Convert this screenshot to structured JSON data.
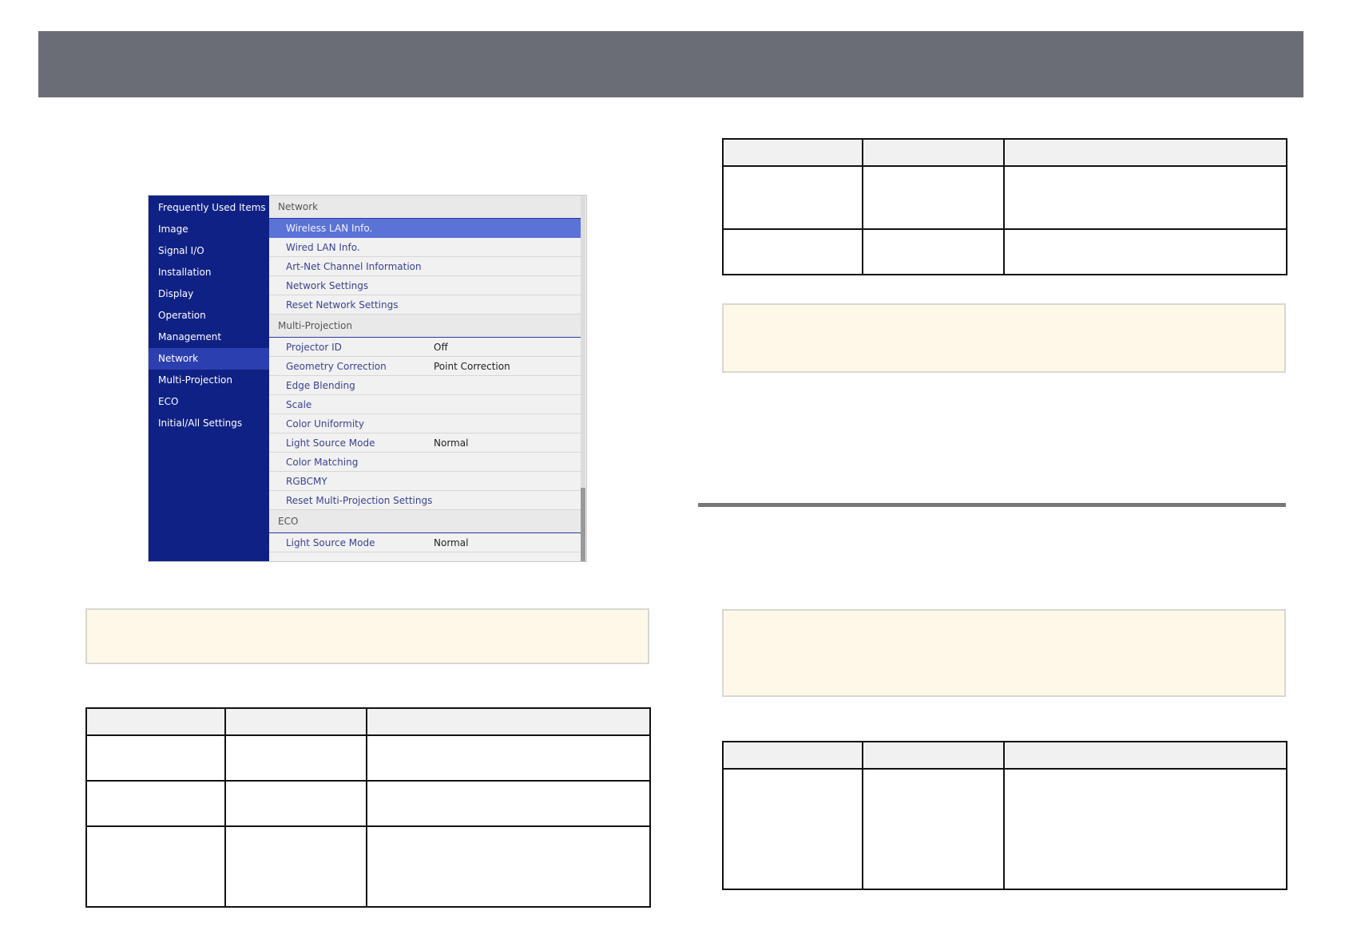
{
  "menu": {
    "sidebar": [
      {
        "label": "Frequently Used Items",
        "active": false
      },
      {
        "label": "Image",
        "active": false
      },
      {
        "label": "Signal I/O",
        "active": false
      },
      {
        "label": "Installation",
        "active": false
      },
      {
        "label": "Display",
        "active": false
      },
      {
        "label": "Operation",
        "active": false
      },
      {
        "label": "Management",
        "active": false
      },
      {
        "label": "Network",
        "active": true
      },
      {
        "label": "Multi-Projection",
        "active": false
      },
      {
        "label": "ECO",
        "active": false
      },
      {
        "label": "Initial/All Settings",
        "active": false
      }
    ],
    "sections": [
      {
        "title": "Network",
        "items": [
          {
            "label": "Wireless LAN Info.",
            "value": "",
            "highlighted": true
          },
          {
            "label": "Wired LAN Info.",
            "value": ""
          },
          {
            "label": "Art-Net Channel Information",
            "value": ""
          },
          {
            "label": "Network Settings",
            "value": ""
          },
          {
            "label": "Reset Network Settings",
            "value": ""
          }
        ]
      },
      {
        "title": "Multi-Projection",
        "items": [
          {
            "label": "Projector ID",
            "value": "Off"
          },
          {
            "label": "Geometry Correction",
            "value": "Point Correction"
          },
          {
            "label": "Edge Blending",
            "value": ""
          },
          {
            "label": "Scale",
            "value": ""
          },
          {
            "label": "Color Uniformity",
            "value": ""
          },
          {
            "label": "Light Source Mode",
            "value": "Normal"
          },
          {
            "label": "Color Matching",
            "value": ""
          },
          {
            "label": "RGBCMY",
            "value": ""
          },
          {
            "label": "Reset Multi-Projection Settings",
            "value": ""
          }
        ]
      },
      {
        "title": "ECO",
        "items": [
          {
            "label": "Light Source Mode",
            "value": "Normal"
          }
        ]
      }
    ]
  },
  "colors": {
    "header_bar": "#6a6d75",
    "sidebar_bg": "#102186",
    "sidebar_active": "#2c3fb0",
    "highlight_row": "#5b72d6",
    "note_bg": "#fdf8e8"
  }
}
